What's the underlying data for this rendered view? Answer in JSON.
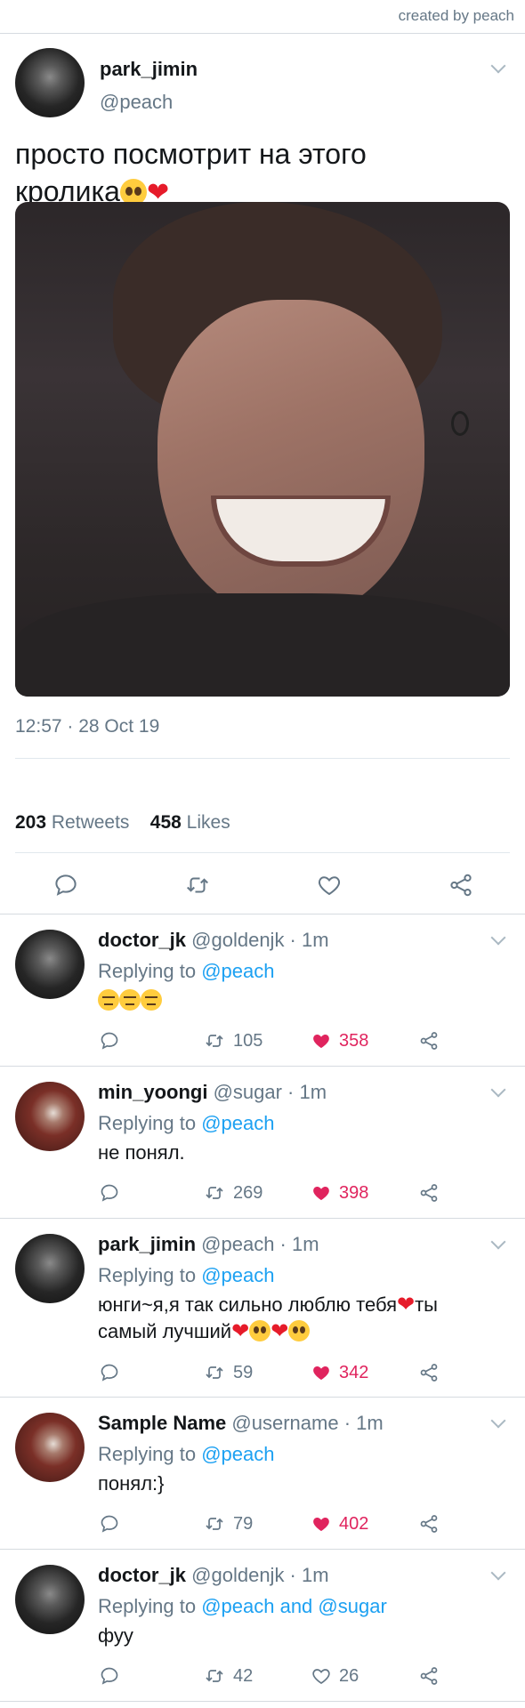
{
  "credit": "created by peach",
  "main_tweet": {
    "name": "park_jimin",
    "handle": "@peach",
    "text_line1": "просто посмотрит на этого",
    "text_line2": "кролика",
    "timestamp": "12:57 · 28 Oct 19",
    "retweets_count": "203",
    "retweets_label": "Retweets",
    "likes_count": "458",
    "likes_label": "Likes",
    "icons": [
      "reply-icon",
      "retweet-icon",
      "like-icon",
      "share-icon"
    ]
  },
  "replies": [
    {
      "name": "doctor_jk",
      "meta": "@goldenjk · 1m",
      "replying_prefix": "Replying to",
      "replying_to": "@peach",
      "text": "",
      "retweets": "105",
      "likes": "358",
      "liked": true
    },
    {
      "name": "min_yoongi",
      "meta": "@sugar · 1m",
      "replying_prefix": "Replying to",
      "replying_to": "@peach",
      "text": "не понял.",
      "retweets": "269",
      "likes": "398",
      "liked": true
    },
    {
      "name": "park_jimin",
      "meta": "@peach · 1m",
      "replying_prefix": "Replying to",
      "replying_to": "@peach",
      "text_line1": "юнги~я,я так сильно люблю тебя",
      "text_line1_end": "ты",
      "text_line2": "самый лучший",
      "retweets": "59",
      "likes": "342",
      "liked": true
    },
    {
      "name": "Sample Name",
      "meta": "@username · 1m",
      "replying_prefix": "Replying to",
      "replying_to": "@peach",
      "text": "понял:}",
      "retweets": "79",
      "likes": "402",
      "liked": true
    },
    {
      "name": "doctor_jk",
      "meta": "@goldenjk · 1m",
      "replying_prefix": "Replying to",
      "replying_to": "@peach and @sugar",
      "text": "фуу",
      "retweets": "42",
      "likes": "26",
      "liked": false
    }
  ],
  "colors": {
    "accent": "#1da1f2",
    "like": "#e0245e",
    "muted": "#657786",
    "text": "#14171a"
  }
}
